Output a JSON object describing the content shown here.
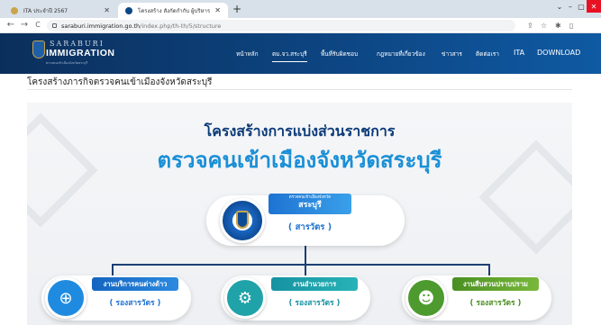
{
  "browser": {
    "tabs": [
      {
        "title": "ITA ประจำปี 2567",
        "active": false
      },
      {
        "title": "โครงสร้าง สังกัดกำกับ ผู้บริหาร",
        "active": true
      }
    ],
    "new_tab_symbol": "+",
    "window_controls": {
      "dropdown": "⌄",
      "minimize": "–",
      "maximize": "▢",
      "close": "✕"
    },
    "nav": {
      "back": "←",
      "forward": "→",
      "reload": "C"
    },
    "url_host": "saraburi.immigration.go.th",
    "url_path": "/index.php/th-th/5/structure",
    "toolbar_icons": [
      "share-icon",
      "star-icon",
      "extensions-icon",
      "sidepanel-icon"
    ]
  },
  "site": {
    "logo_top": "SARABURI",
    "logo_main": "IMMIGRATION",
    "logo_sub": "ตรวจคนเข้าเมืองจังหวัดสระบุรี",
    "nav": [
      {
        "label": "หน้าหลัก",
        "active": false
      },
      {
        "label": "ตม.จว.สระบุรี",
        "active": true
      },
      {
        "label": "พื้นที่รับผิดชอบ",
        "active": false
      },
      {
        "label": "กฎหมายที่เกี่ยวข้อง",
        "active": false
      },
      {
        "label": "ข่าวสาร",
        "active": false
      },
      {
        "label": "ติดต่อเรา",
        "active": false
      },
      {
        "label": "ITA",
        "active": false
      },
      {
        "label": "DOWNLOAD",
        "active": false
      }
    ]
  },
  "page": {
    "title": "โครงสร้างภารกิจตรวจคนเข้าเมืองจังหวัดสระบุรี"
  },
  "banner": {
    "title1": "โครงสร้างการแบ่งส่วนราชการ",
    "title2": "ตรวจคนเข้าเมืองจังหวัดสระบุรี",
    "top": {
      "small": "ตรวจคนเข้าเมืองจังหวัด",
      "big": "สระบุรี",
      "sub": "( สารวัตร )"
    },
    "cards": [
      {
        "label": "งานบริการคนต่างด้าว",
        "sub": "( รองสารวัตร )",
        "color": "#1f8be0"
      },
      {
        "label": "งานอำนวยการ",
        "sub": "( รองสารวัตร )",
        "color": "#1fa3a9"
      },
      {
        "label": "งานสืบสวนปราบปราม",
        "sub": "( รองสารวัตร )",
        "color": "#4d9a2f"
      }
    ]
  }
}
